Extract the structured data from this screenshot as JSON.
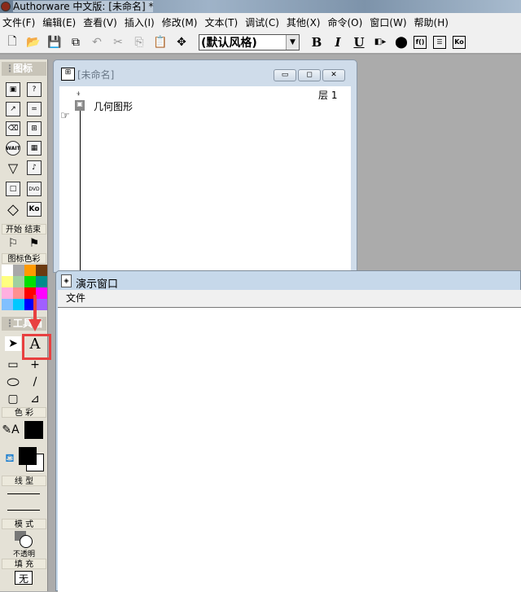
{
  "app": {
    "title": "Authorware 中文版: [未命名] *"
  },
  "menu": [
    "文件(F)",
    "编辑(E)",
    "查看(V)",
    "插入(I)",
    "修改(M)",
    "文本(T)",
    "调试(C)",
    "其他(X)",
    "命令(O)",
    "窗口(W)",
    "帮助(H)"
  ],
  "toolbar": {
    "style_value": "(默认风格)",
    "bold": "B",
    "italic": "I",
    "underline": "U"
  },
  "icon_palette": {
    "title": "图标",
    "start_label": "开始",
    "end_label": "结束",
    "color_label": "图标色彩",
    "colors": [
      "#ffffff",
      "#a8a8a8",
      "#ff9a00",
      "#6b3a10",
      "#ffff80",
      "#a0d0a0",
      "#00e000",
      "#008c8c",
      "#ffb0e0",
      "#ff9090",
      "#ff0000",
      "#ff00ff",
      "#80c0ff",
      "#00c8ff",
      "#0000ff",
      "#a060ff"
    ]
  },
  "tools_palette": {
    "title": "工具箱",
    "color_label": "色 彩",
    "linestyle_label": "线 型",
    "mode_label": "模 式",
    "mode_value": "不透明",
    "fill_label": "填 充",
    "fill_value": "无"
  },
  "flow_window": {
    "title": "[未命名]",
    "level": "层 1",
    "icon_label": "几何图形"
  },
  "presentation_window": {
    "title": "演示窗口",
    "menu_file": "文件"
  },
  "accent": {
    "highlight": "#e84040"
  }
}
